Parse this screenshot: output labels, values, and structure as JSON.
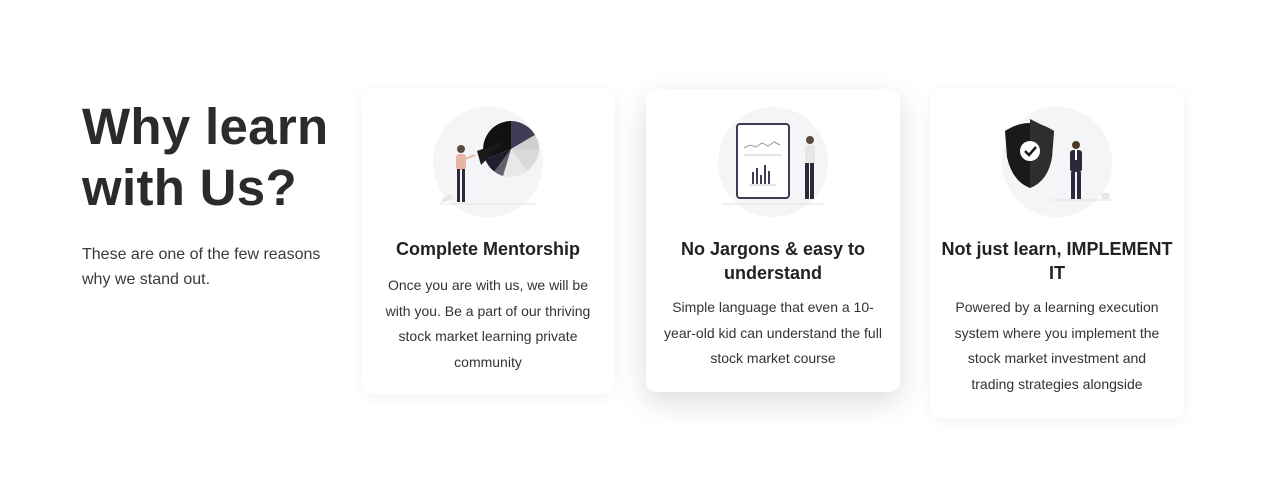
{
  "section": {
    "title": "Why learn with Us?",
    "subtitle": "These are one of the few reasons why we stand out."
  },
  "cards": [
    {
      "title": "Complete Mentorship",
      "description": "Once you are with us, we will be with you. Be a part of our thriving stock market learning private community",
      "icon": "pie-chart-presenter-illustration"
    },
    {
      "title": "No Jargons & easy to understand",
      "description": "Simple language that even a 10-year-old kid can understand the full stock market course",
      "icon": "tablet-chart-illustration"
    },
    {
      "title": "Not just learn, IMPLEMENT IT",
      "description": "Powered by a learning execution system where you implement the stock market investment and trading strategies alongside",
      "icon": "shield-businessman-illustration"
    }
  ],
  "colors": {
    "heading": "#2b2b2b",
    "card_background": "#ffffff",
    "illustration_dark": "#1f1f2e",
    "illustration_accent": "#3f3d56"
  }
}
